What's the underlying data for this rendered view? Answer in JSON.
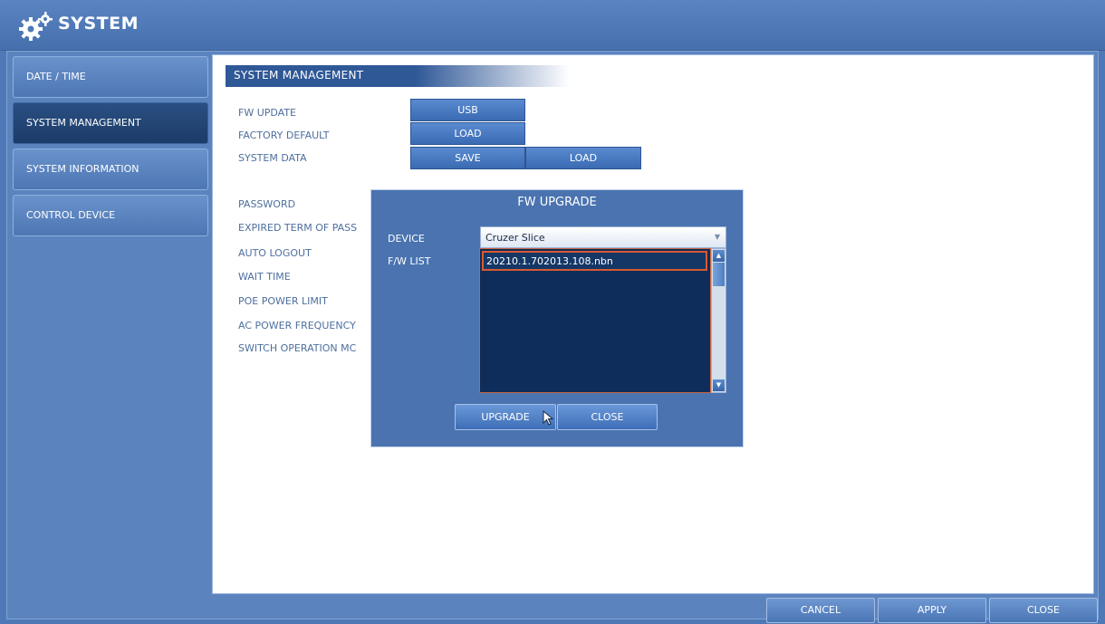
{
  "header": {
    "title": "SYSTEM",
    "icon": "gear-icon"
  },
  "sidebar": {
    "items": [
      {
        "label": "DATE / TIME"
      },
      {
        "label": "SYSTEM MANAGEMENT",
        "active": true
      },
      {
        "label": "SYSTEM INFORMATION"
      },
      {
        "label": "CONTROL DEVICE"
      }
    ]
  },
  "main": {
    "section_title": "SYSTEM MANAGEMENT",
    "rows": {
      "fw_update": {
        "label": "FW UPDATE",
        "button": "USB"
      },
      "factory_default": {
        "label": "FACTORY DEFAULT",
        "button": "LOAD"
      },
      "system_data": {
        "label": "SYSTEM DATA",
        "save": "SAVE",
        "load": "LOAD"
      }
    },
    "settings": [
      "PASSWORD",
      "EXPIRED TERM OF PASS",
      "AUTO LOGOUT",
      "WAIT TIME",
      "POE POWER LIMIT",
      "AC POWER FREQUENCY",
      "SWITCH OPERATION MC"
    ]
  },
  "dialog": {
    "title": "FW UPGRADE",
    "device_label": "DEVICE",
    "device_value": "Cruzer Slice",
    "list_label": "F/W LIST",
    "files": [
      "20210.1.702013.108.nbn"
    ],
    "upgrade_label": "UPGRADE",
    "close_label": "CLOSE"
  },
  "footer": {
    "cancel": "CANCEL",
    "apply": "APPLY",
    "close": "CLOSE"
  },
  "colors": {
    "accent": "#4f79b6",
    "selection": "#d85a30",
    "list_bg": "#0e2d5a"
  }
}
